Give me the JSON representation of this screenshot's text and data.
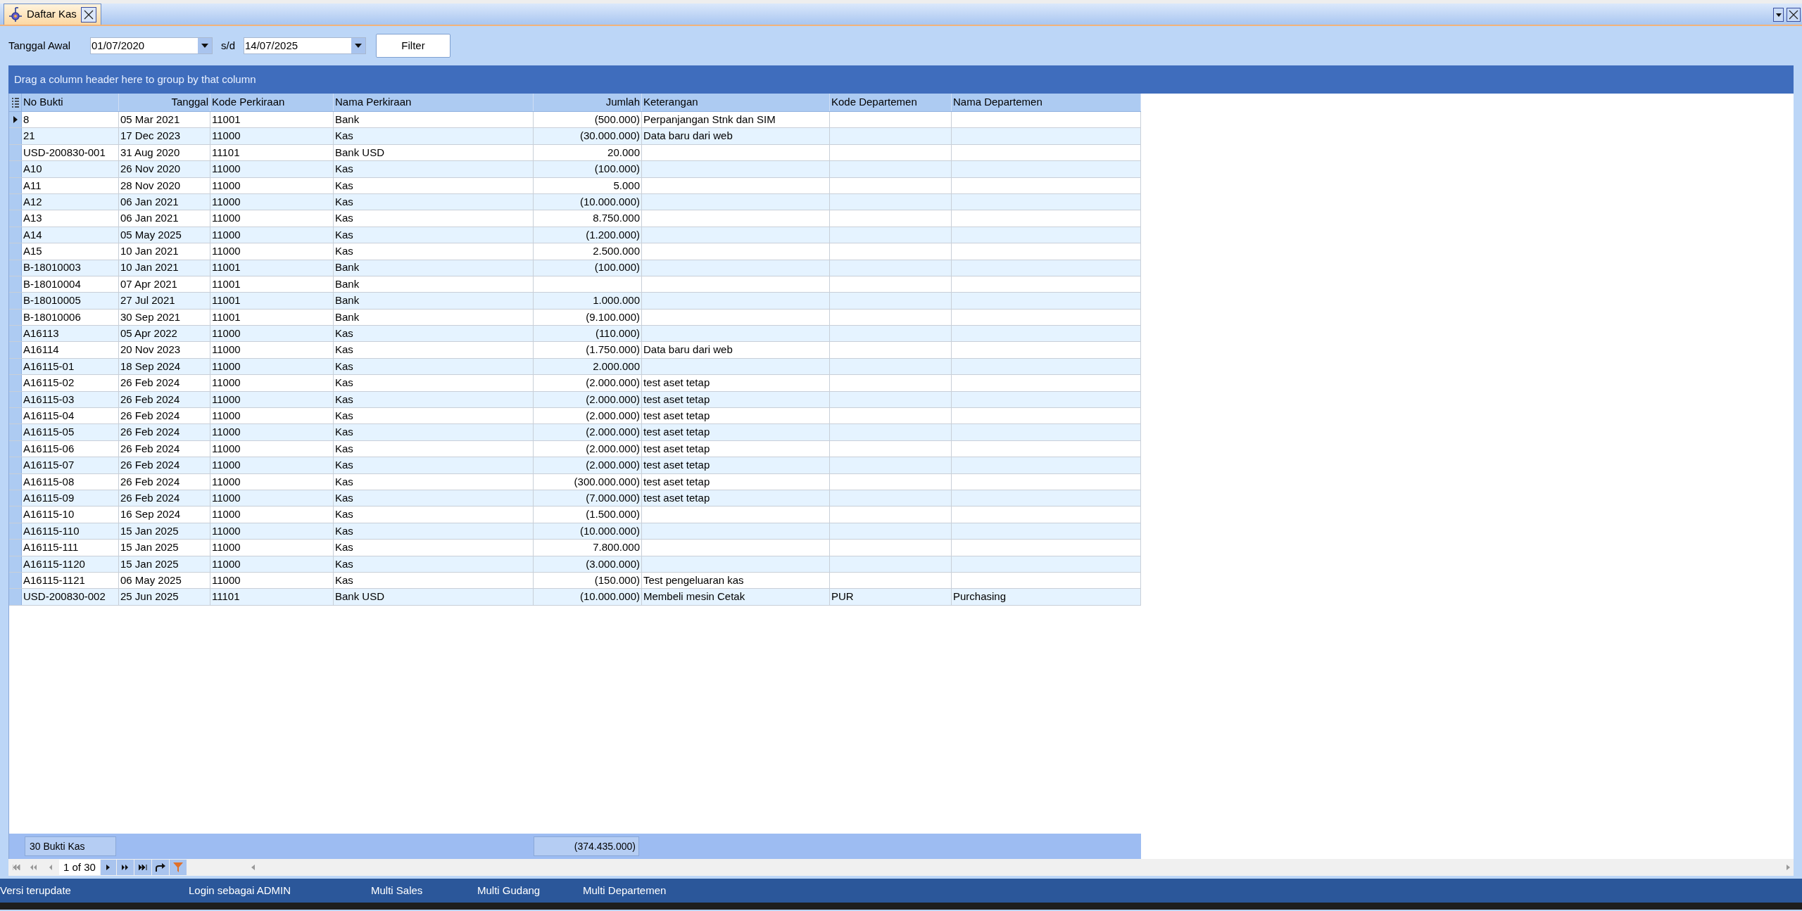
{
  "tab": {
    "title": "Daftar Kas",
    "selected": true
  },
  "filter": {
    "label": "Tanggal Awal",
    "date_from": "01/07/2020",
    "separator": "s/d",
    "date_to": "14/07/2025",
    "button": "Filter"
  },
  "group_panel": "Drag a column header here to group by that column",
  "table": {
    "columns": [
      "No Bukti",
      "Tanggal",
      "Kode Perkiraan",
      "Nama Perkiraan",
      "Jumlah",
      "Keterangan",
      "Kode Departemen",
      "Nama Departemen"
    ],
    "rows": [
      {
        "selected": true,
        "no_bukti": "8",
        "tanggal": "05 Mar 2021",
        "kode_perkiraan": "11001",
        "nama_perkiraan": "Bank",
        "jumlah": "(500.000)",
        "keterangan": "Perpanjangan Stnk dan SIM"
      },
      {
        "selected": false,
        "no_bukti": "21",
        "tanggal": "17 Dec 2023",
        "kode_perkiraan": "11000",
        "nama_perkiraan": "Kas",
        "jumlah": "(30.000.000)",
        "keterangan": "Data baru dari web"
      },
      {
        "selected": false,
        "no_bukti": "USD-200830-001",
        "tanggal": "31 Aug 2020",
        "kode_perkiraan": "11101",
        "nama_perkiraan": "Bank USD",
        "jumlah": "20.000"
      },
      {
        "selected": false,
        "no_bukti": "A10",
        "tanggal": "26 Nov 2020",
        "kode_perkiraan": "11000",
        "nama_perkiraan": "Kas",
        "jumlah": "(100.000)"
      },
      {
        "selected": false,
        "no_bukti": "A11",
        "tanggal": "28 Nov 2020",
        "kode_perkiraan": "11000",
        "nama_perkiraan": "Kas",
        "jumlah": "5.000"
      },
      {
        "selected": false,
        "no_bukti": "A12",
        "tanggal": "06 Jan 2021",
        "kode_perkiraan": "11000",
        "nama_perkiraan": "Kas",
        "jumlah": "(10.000.000)"
      },
      {
        "selected": false,
        "no_bukti": "A13",
        "tanggal": "06 Jan 2021",
        "kode_perkiraan": "11000",
        "nama_perkiraan": "Kas",
        "jumlah": "8.750.000"
      },
      {
        "selected": false,
        "no_bukti": "A14",
        "tanggal": "05 May 2025",
        "kode_perkiraan": "11000",
        "nama_perkiraan": "Kas",
        "jumlah": "(1.200.000)"
      },
      {
        "selected": false,
        "no_bukti": "A15",
        "tanggal": "10 Jan 2021",
        "kode_perkiraan": "11000",
        "nama_perkiraan": "Kas",
        "jumlah": "2.500.000"
      },
      {
        "selected": false,
        "no_bukti": "B-18010003",
        "tanggal": "10 Jan 2021",
        "kode_perkiraan": "11001",
        "nama_perkiraan": "Bank",
        "jumlah": "(100.000)"
      },
      {
        "selected": false,
        "no_bukti": "B-18010004",
        "tanggal": "07 Apr 2021",
        "kode_perkiraan": "11001",
        "nama_perkiraan": "Bank"
      },
      {
        "selected": false,
        "no_bukti": "B-18010005",
        "tanggal": "27 Jul 2021",
        "kode_perkiraan": "11001",
        "nama_perkiraan": "Bank",
        "jumlah": "1.000.000"
      },
      {
        "selected": false,
        "no_bukti": "B-18010006",
        "tanggal": "30 Sep 2021",
        "kode_perkiraan": "11001",
        "nama_perkiraan": "Bank",
        "jumlah": "(9.100.000)"
      },
      {
        "selected": false,
        "no_bukti": "A16113",
        "tanggal": "05 Apr 2022",
        "kode_perkiraan": "11000",
        "nama_perkiraan": "Kas",
        "jumlah": "(110.000)"
      },
      {
        "selected": false,
        "no_bukti": "A16114",
        "tanggal": "20 Nov 2023",
        "kode_perkiraan": "11000",
        "nama_perkiraan": "Kas",
        "jumlah": "(1.750.000)",
        "keterangan": "Data baru dari web"
      },
      {
        "selected": false,
        "no_bukti": "A16115-01",
        "tanggal": "18 Sep 2024",
        "kode_perkiraan": "11000",
        "nama_perkiraan": "Kas",
        "jumlah": "2.000.000"
      },
      {
        "selected": false,
        "no_bukti": "A16115-02",
        "tanggal": "26 Feb 2024",
        "kode_perkiraan": "11000",
        "nama_perkiraan": "Kas",
        "jumlah": "(2.000.000)",
        "keterangan": "test aset tetap"
      },
      {
        "selected": false,
        "no_bukti": "A16115-03",
        "tanggal": "26 Feb 2024",
        "kode_perkiraan": "11000",
        "nama_perkiraan": "Kas",
        "jumlah": "(2.000.000)",
        "keterangan": "test aset tetap"
      },
      {
        "selected": false,
        "no_bukti": "A16115-04",
        "tanggal": "26 Feb 2024",
        "kode_perkiraan": "11000",
        "nama_perkiraan": "Kas",
        "jumlah": "(2.000.000)",
        "keterangan": "test aset tetap"
      },
      {
        "selected": false,
        "no_bukti": "A16115-05",
        "tanggal": "26 Feb 2024",
        "kode_perkiraan": "11000",
        "nama_perkiraan": "Kas",
        "jumlah": "(2.000.000)",
        "keterangan": "test aset tetap"
      },
      {
        "selected": false,
        "no_bukti": "A16115-06",
        "tanggal": "26 Feb 2024",
        "kode_perkiraan": "11000",
        "nama_perkiraan": "Kas",
        "jumlah": "(2.000.000)",
        "keterangan": "test aset tetap"
      },
      {
        "selected": false,
        "no_bukti": "A16115-07",
        "tanggal": "26 Feb 2024",
        "kode_perkiraan": "11000",
        "nama_perkiraan": "Kas",
        "jumlah": "(2.000.000)",
        "keterangan": "test aset tetap"
      },
      {
        "selected": false,
        "no_bukti": "A16115-08",
        "tanggal": "26 Feb 2024",
        "kode_perkiraan": "11000",
        "nama_perkiraan": "Kas",
        "jumlah": "(300.000.000)",
        "keterangan": "test aset tetap"
      },
      {
        "selected": false,
        "no_bukti": "A16115-09",
        "tanggal": "26 Feb 2024",
        "kode_perkiraan": "11000",
        "nama_perkiraan": "Kas",
        "jumlah": "(7.000.000)",
        "keterangan": "test aset tetap"
      },
      {
        "selected": false,
        "no_bukti": "A16115-10",
        "tanggal": "16 Sep 2024",
        "kode_perkiraan": "11000",
        "nama_perkiraan": "Kas",
        "jumlah": "(1.500.000)"
      },
      {
        "selected": false,
        "no_bukti": "A16115-110",
        "tanggal": "15 Jan 2025",
        "kode_perkiraan": "11000",
        "nama_perkiraan": "Kas",
        "jumlah": "(10.000.000)"
      },
      {
        "selected": false,
        "no_bukti": "A16115-111",
        "tanggal": "15 Jan 2025",
        "kode_perkiraan": "11000",
        "nama_perkiraan": "Kas",
        "jumlah": "7.800.000"
      },
      {
        "selected": false,
        "no_bukti": "A16115-1120",
        "tanggal": "15 Jan 2025",
        "kode_perkiraan": "11000",
        "nama_perkiraan": "Kas",
        "jumlah": "(3.000.000)"
      },
      {
        "selected": false,
        "no_bukti": "A16115-1121",
        "tanggal": "06 May 2025",
        "kode_perkiraan": "11000",
        "nama_perkiraan": "Kas",
        "jumlah": "(150.000)",
        "keterangan": "Test pengeluaran kas"
      },
      {
        "selected": false,
        "no_bukti": "USD-200830-002",
        "tanggal": "25 Jun 2025",
        "kode_perkiraan": "11101",
        "nama_perkiraan": "Bank USD",
        "jumlah": "(10.000.000)",
        "keterangan": "Membeli mesin Cetak",
        "kode_departemen": "PUR",
        "nama_departemen": "Purchasing"
      }
    ],
    "footer": {
      "count": "30 Bukti Kas",
      "total": "(374.435.000)"
    }
  },
  "navigator": {
    "position": "1 of 30"
  },
  "status_bar": [
    "Versi terupdate",
    "Login sebagai ADMIN",
    "Multi Sales",
    "Multi Gudang",
    "Multi Departemen"
  ]
}
